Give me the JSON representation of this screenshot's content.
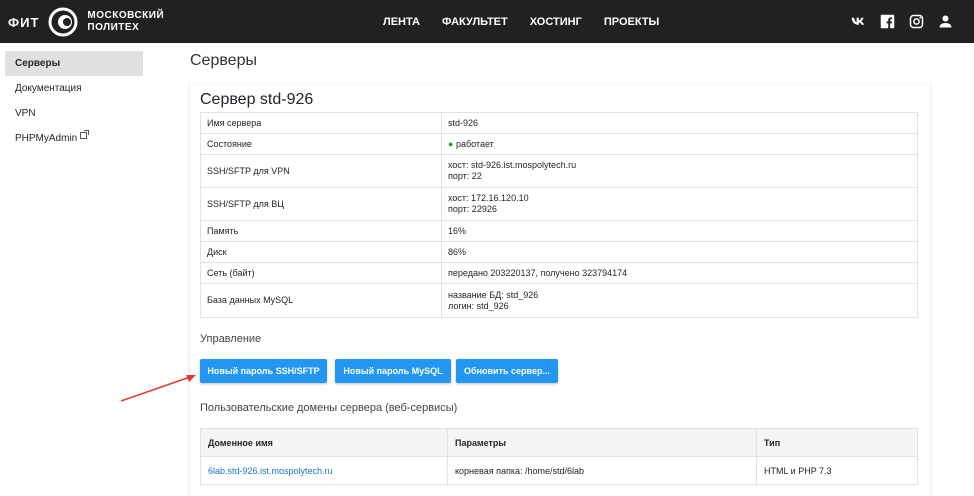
{
  "brand": {
    "fit": "ФИТ",
    "line1": "МОСКОВСКИЙ",
    "line2": "ПОЛИТЕХ",
    "logo_icon": "polytech-logo-icon"
  },
  "nav": {
    "items": [
      "ЛЕНТА",
      "ФАКУЛЬТЕТ",
      "ХОСТИНГ",
      "ПРОЕКТЫ"
    ]
  },
  "social": [
    "vk-icon",
    "facebook-icon",
    "instagram-icon",
    "user-icon"
  ],
  "sidebar": {
    "items": [
      {
        "label": "Серверы",
        "active": true
      },
      {
        "label": "Документация"
      },
      {
        "label": "VPN"
      },
      {
        "label": "PHPMyAdmin",
        "external": true
      }
    ]
  },
  "page": {
    "title": "Серверы"
  },
  "server": {
    "title": "Сервер std-926",
    "rows": [
      {
        "label": "Имя сервера",
        "value": "std-926"
      },
      {
        "label": "Состояние",
        "status_dot": "●",
        "value": "работает"
      },
      {
        "label": "SSH/SFTP для VPN",
        "value": "хост: std-926.ist.mospolytech.ru",
        "value2": "порт: 22"
      },
      {
        "label": "SSH/SFTP для ВЦ",
        "value": "хост: 172.16.120.10",
        "value2": "порт: 22926"
      },
      {
        "label": "Память",
        "value": "16%"
      },
      {
        "label": "Диск",
        "value": "86%"
      },
      {
        "label": "Сеть (байт)",
        "value": "передано 203220137, получено 323794174"
      },
      {
        "label": "База данных MySQL",
        "value": "название БД: std_926",
        "value2": "логин: std_926"
      }
    ]
  },
  "management": {
    "label": "Управление",
    "buttons": [
      "Новый пароль SSH/SFTP",
      "Новый пароль MySQL",
      "Обновить сервер..."
    ]
  },
  "domains": {
    "label": "Пользовательские домены сервера (веб-сервисы)",
    "headers": [
      "Доменное имя",
      "Параметры",
      "Тип"
    ],
    "rows": [
      {
        "domain": "6lab.std-926.ist.mospolytech.ru",
        "params": "корневая папка: /home/std/6lab",
        "type": "HTML и PHP 7.3"
      }
    ]
  },
  "colors": {
    "accent": "#2196f3",
    "topbar": "#212121",
    "status_ok": "#2e9b2e",
    "arrow": "#e53935"
  }
}
